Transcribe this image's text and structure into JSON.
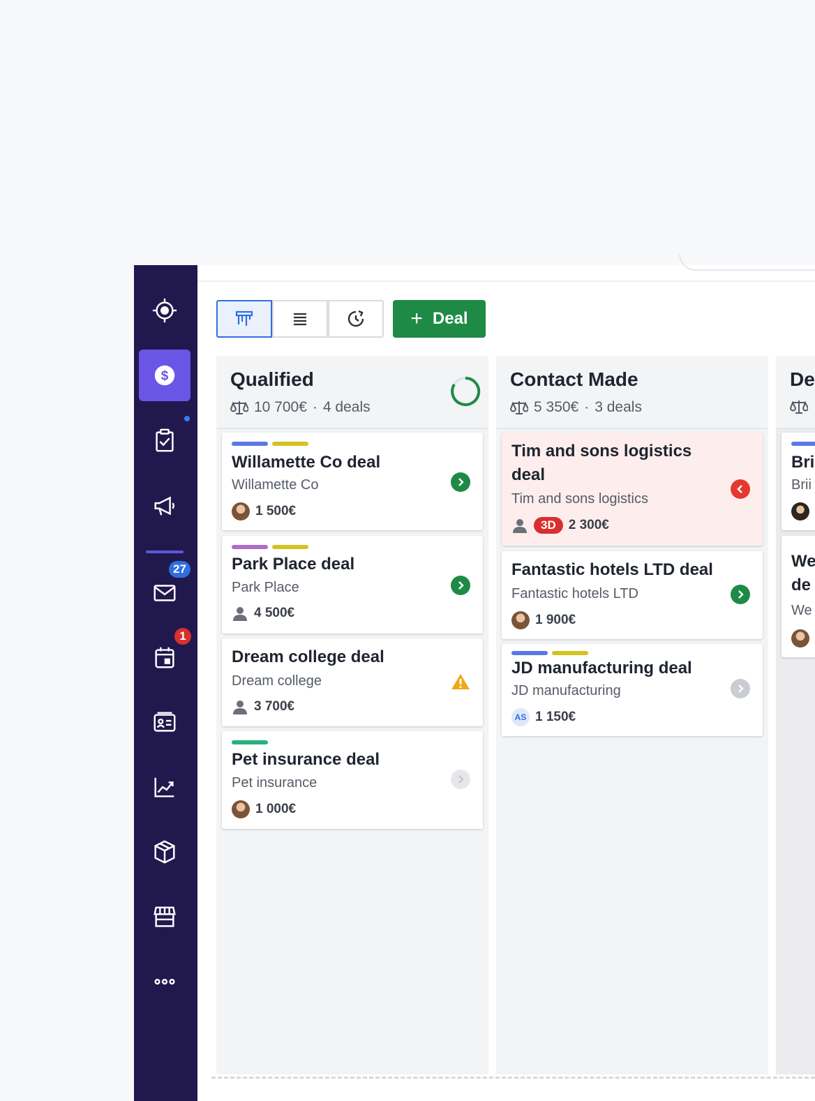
{
  "sidebar": {
    "items": [
      {
        "icon": "target-icon"
      },
      {
        "icon": "dollar-icon",
        "active": true
      },
      {
        "icon": "clipboard-check-icon"
      },
      {
        "icon": "megaphone-icon"
      },
      {
        "icon": "mail-icon",
        "badge": "27"
      },
      {
        "icon": "calendar-icon",
        "badge": "1"
      },
      {
        "icon": "contact-card-icon"
      },
      {
        "icon": "chart-line-icon"
      },
      {
        "icon": "box-icon"
      },
      {
        "icon": "store-icon"
      },
      {
        "icon": "more-icon"
      }
    ],
    "mail_badge": "27",
    "calendar_badge": "1"
  },
  "toolbar": {
    "add_deal_label": "Deal",
    "add_deal_plus": "+"
  },
  "colors": {
    "sidebar_bg": "#21194e",
    "active_nav": "#6a55e6",
    "primary_green": "#1f8a45",
    "danger_red": "#d8302f",
    "accent_blue": "#2e6fe0"
  },
  "pipeline": {
    "columns": [
      {
        "title": "Qualified",
        "total": "10 700€",
        "separator": "·",
        "count": "4 deals",
        "deals": [
          {
            "title": "Willamette Co deal",
            "org": "Willamette Co",
            "value": "1 500€"
          },
          {
            "title": "Park Place deal",
            "org": "Park Place",
            "value": "4 500€"
          },
          {
            "title": "Dream college deal",
            "org": "Dream college",
            "value": "3 700€"
          },
          {
            "title": "Pet insurance deal",
            "org": "Pet insurance",
            "value": "1 000€"
          }
        ]
      },
      {
        "title": "Contact Made",
        "total": "5 350€",
        "separator": "·",
        "count": "3 deals",
        "deals": [
          {
            "title_line1": "Tim and sons logistics",
            "title_line2": "deal",
            "org": "Tim and sons logistics",
            "rotting": "3D",
            "value": "2 300€"
          },
          {
            "title": "Fantastic hotels LTD deal",
            "org": "Fantastic hotels LTD",
            "value": "1 900€"
          },
          {
            "title": "JD manufacturing deal",
            "org": "JD manufacturing",
            "owner_initials": "AS",
            "value": "1 150€"
          }
        ]
      },
      {
        "title": "De",
        "deals": [
          {
            "title": "Bri",
            "org": "Brii"
          },
          {
            "title_line1": "We",
            "title_line2": "de",
            "org": "We"
          }
        ]
      }
    ]
  }
}
